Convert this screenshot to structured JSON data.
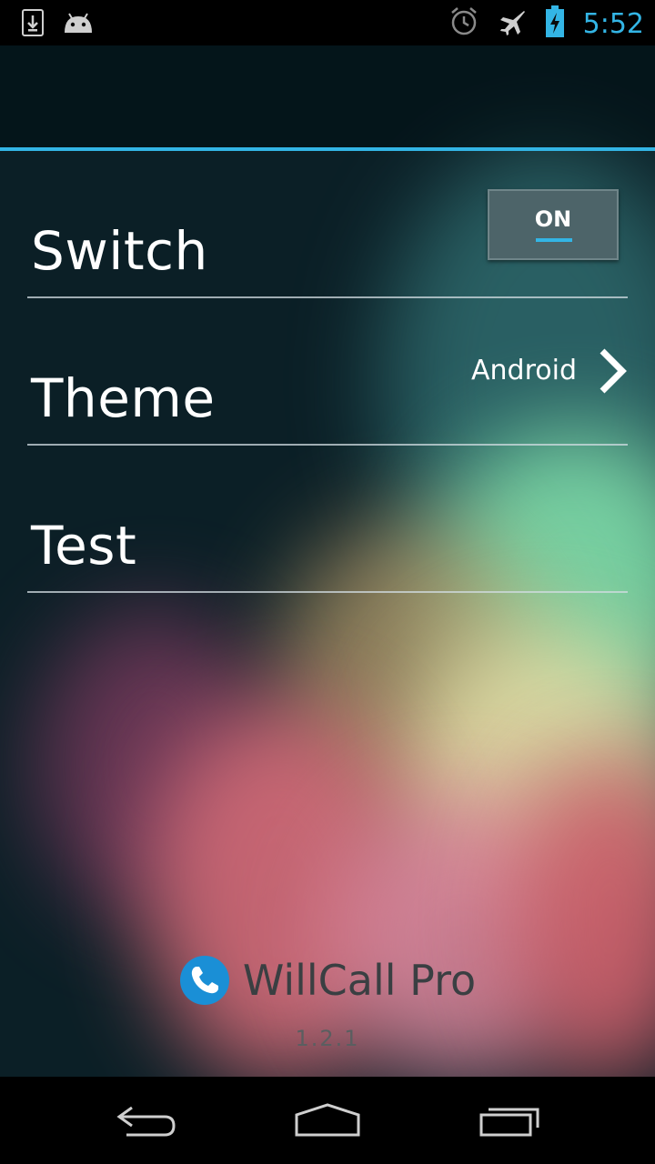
{
  "status_bar": {
    "time": "5:52",
    "icons": [
      "download-icon",
      "android-icon",
      "alarm-icon",
      "airplane-mode-icon",
      "battery-charging-icon"
    ]
  },
  "settings": {
    "switch_label": "Switch",
    "switch_state": "ON",
    "theme_label": "Theme",
    "theme_value": "Android",
    "test_label": "Test"
  },
  "footer": {
    "app_name": "WillCall Pro",
    "version": "1.2.1"
  },
  "nav_bar": {
    "buttons": [
      "back-icon",
      "home-icon",
      "recent-apps-icon"
    ]
  },
  "colors": {
    "accent": "#33b5e5",
    "status_text": "#33b5e5"
  }
}
